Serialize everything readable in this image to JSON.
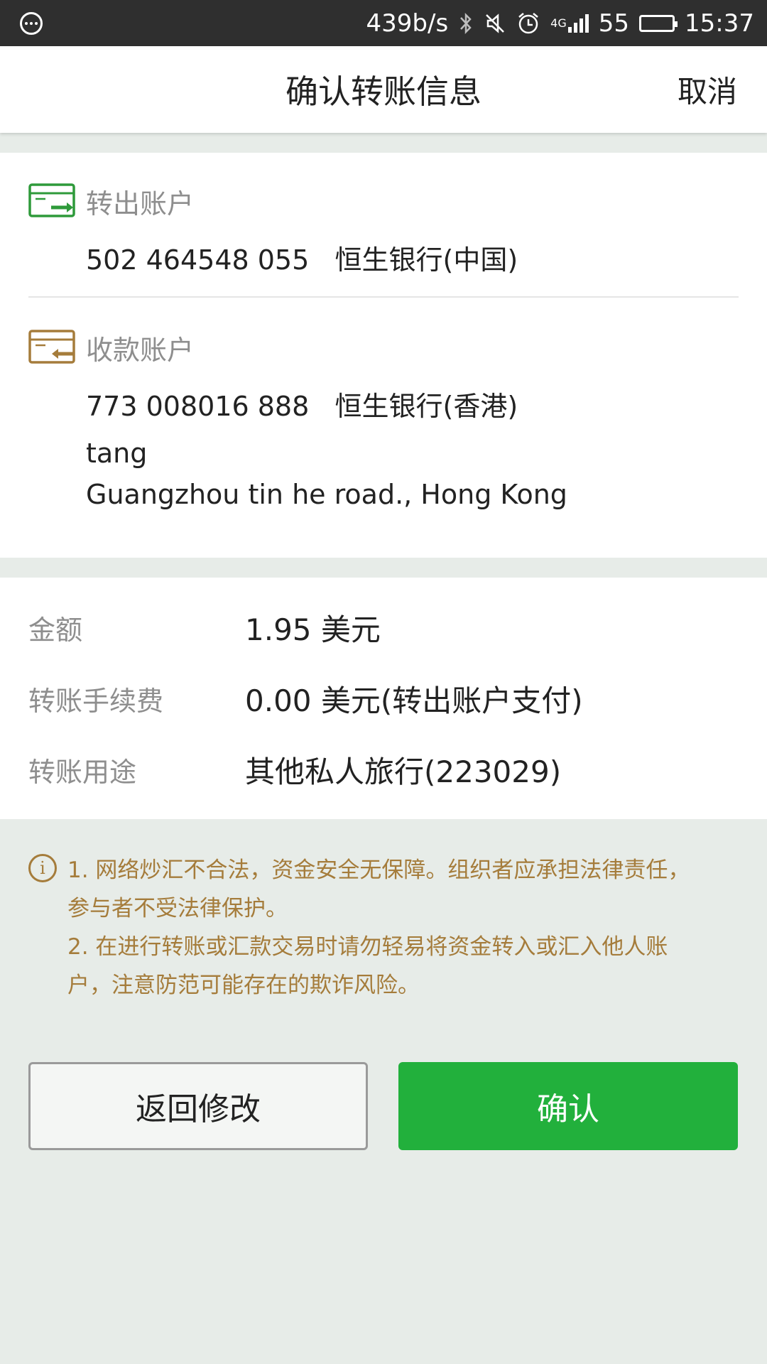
{
  "status_bar": {
    "net_speed": "439b/s",
    "network": "4G",
    "battery_level": "55",
    "battery_fraction": 0.55,
    "time": "15:37",
    "icons": [
      "message-icon",
      "bluetooth-icon",
      "mute-icon",
      "alarm-icon",
      "signal-icon",
      "battery-icon"
    ]
  },
  "nav": {
    "title": "确认转账信息",
    "cancel": "取消"
  },
  "from_account": {
    "label": "转出账户",
    "number": "502 464548 055",
    "bank": "恒生银行(中国)",
    "icon": "card-transfer-out-icon",
    "icon_color": "#2e9a3a"
  },
  "to_account": {
    "label": "收款账户",
    "number": "773 008016 888",
    "bank": "恒生银行(香港)",
    "name": "tang",
    "address": "Guangzhou tin he road., Hong Kong",
    "icon": "card-transfer-in-icon",
    "icon_color": "#a57c3b"
  },
  "details": {
    "amount_label": "金额",
    "amount_value": "1.95 美元",
    "fee_label": "转账手续费",
    "fee_value": "0.00 美元(转出账户支付)",
    "purpose_label": "转账用途",
    "purpose_value": "其他私人旅行(223029)"
  },
  "notice": {
    "icon": "info-icon",
    "line1": "1. 网络炒汇不合法，资金安全无保障。组织者应承担法律责任，",
    "line2": "参与者不受法律保护。",
    "line3": "2. 在进行转账或汇款交易时请勿轻易将资金转入或汇入他人账",
    "line4": "户，注意防范可能存在的欺诈风险。",
    "color": "#a57c3b"
  },
  "buttons": {
    "back": "返回修改",
    "confirm": "确认",
    "confirm_color": "#22b03c"
  }
}
